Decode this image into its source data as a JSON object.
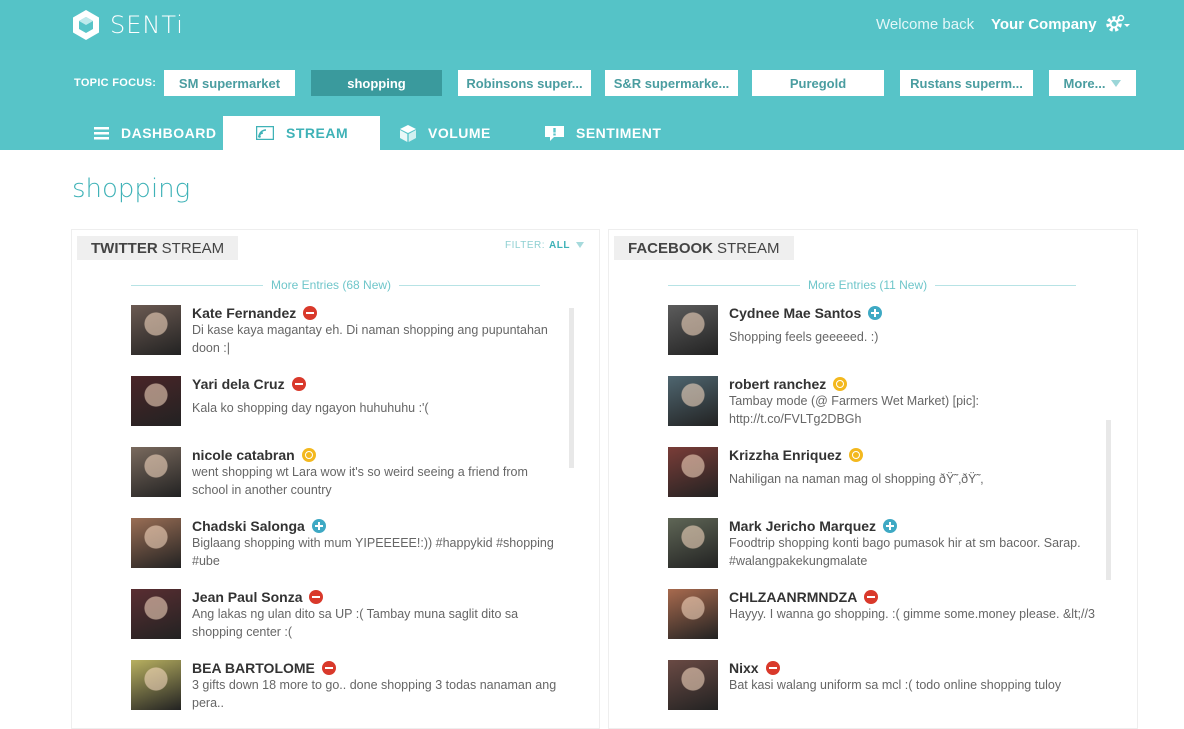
{
  "app": {
    "name": "SENTi"
  },
  "header": {
    "welcome": "Welcome back",
    "company": "Your Company"
  },
  "topic_focus": {
    "label": "TOPIC FOCUS:",
    "items": [
      "SM supermarket",
      "shopping",
      "Robinsons super...",
      "S&R supermarke...",
      "Puregold",
      "Rustans superm...",
      "More..."
    ],
    "active": "shopping"
  },
  "nav": {
    "tabs": [
      {
        "label": "DASHBOARD",
        "icon": "menu-icon"
      },
      {
        "label": "STREAM",
        "icon": "stream-icon"
      },
      {
        "label": "VOLUME",
        "icon": "cube-icon"
      },
      {
        "label": "SENTIMENT",
        "icon": "speech-bubble-icon"
      }
    ],
    "active": "STREAM"
  },
  "page": {
    "title": "shopping"
  },
  "twitter": {
    "title_bold": "TWITTER",
    "title_rest": "STREAM",
    "filter_label": "FILTER:",
    "filter_value": "ALL",
    "more_entries": "More Entries (68 New)",
    "entries": [
      {
        "name": "Kate Fernandez",
        "sentiment": "negative",
        "text": "Di kase kaya magantay eh. Di naman shopping ang pupuntahan doon :|",
        "avatar_color": "#6b5a52"
      },
      {
        "name": "Yari dela Cruz",
        "sentiment": "negative",
        "text": "Kala ko shopping day ngayon huhuhuhu :'(",
        "avatar_color": "#4a2528"
      },
      {
        "name": "nicole catabran",
        "sentiment": "neutral",
        "text": "went shopping wt Lara wow it's so weird seeing a friend from school in another country",
        "avatar_color": "#7a6a5e"
      },
      {
        "name": "Chadski Salonga",
        "sentiment": "positive",
        "text": "Biglaang shopping with mum YIPEEEEE!:)) #happykid #shopping #ube",
        "avatar_color": "#9a6e55"
      },
      {
        "name": "Jean Paul Sonza",
        "sentiment": "negative",
        "text": "Ang lakas ng ulan dito sa UP :( Tambay muna saglit dito sa shopping center :(",
        "avatar_color": "#5a2e32"
      },
      {
        "name": "BEA BARTOLOME",
        "sentiment": "negative",
        "text": "3 gifts down 18 more to go.. done shopping 3 todas nanaman ang pera..",
        "avatar_color": "#b8b060"
      }
    ]
  },
  "facebook": {
    "title_bold": "FACEBOOK",
    "title_rest": "STREAM",
    "more_entries": "More Entries (11 New)",
    "entries": [
      {
        "name": "Cydnee Mae Santos",
        "sentiment": "positive",
        "text": "Shopping feels geeeeed. :)",
        "avatar_color": "#5c5c5c"
      },
      {
        "name": "robert ranchez",
        "sentiment": "neutral",
        "text": "Tambay mode (@ Farmers Wet Market) [pic]: http://t.co/FVLTg2DBGh",
        "avatar_color": "#4f6670"
      },
      {
        "name": "Krizzha Enriquez",
        "sentiment": "neutral",
        "text": "Nahiligan na naman mag ol shopping ðŸ˜‚ðŸ˜‚",
        "avatar_color": "#7a3d38"
      },
      {
        "name": "Mark Jericho Marquez",
        "sentiment": "positive",
        "text": "Foodtrip shopping konti bago pumasok hir at sm bacoor. Sarap. #walangpakekungmalate",
        "avatar_color": "#5f6656"
      },
      {
        "name": "CHLZAANRMNDZA",
        "sentiment": "negative",
        "text": "Hayyy. I wanna go shopping. :( gimme some.money please. &lt;//3",
        "avatar_color": "#a86a4e"
      },
      {
        "name": "Nixx",
        "sentiment": "negative",
        "text": "Bat kasi walang uniform sa mcl :( todo online shopping tuloy",
        "avatar_color": "#6a4a44"
      }
    ]
  },
  "colors": {
    "brand": "#57c4c8",
    "active_topic": "#3a9a9d",
    "negative": "#d9392b",
    "positive": "#3ea9c4",
    "neutral": "#f3b81e"
  }
}
